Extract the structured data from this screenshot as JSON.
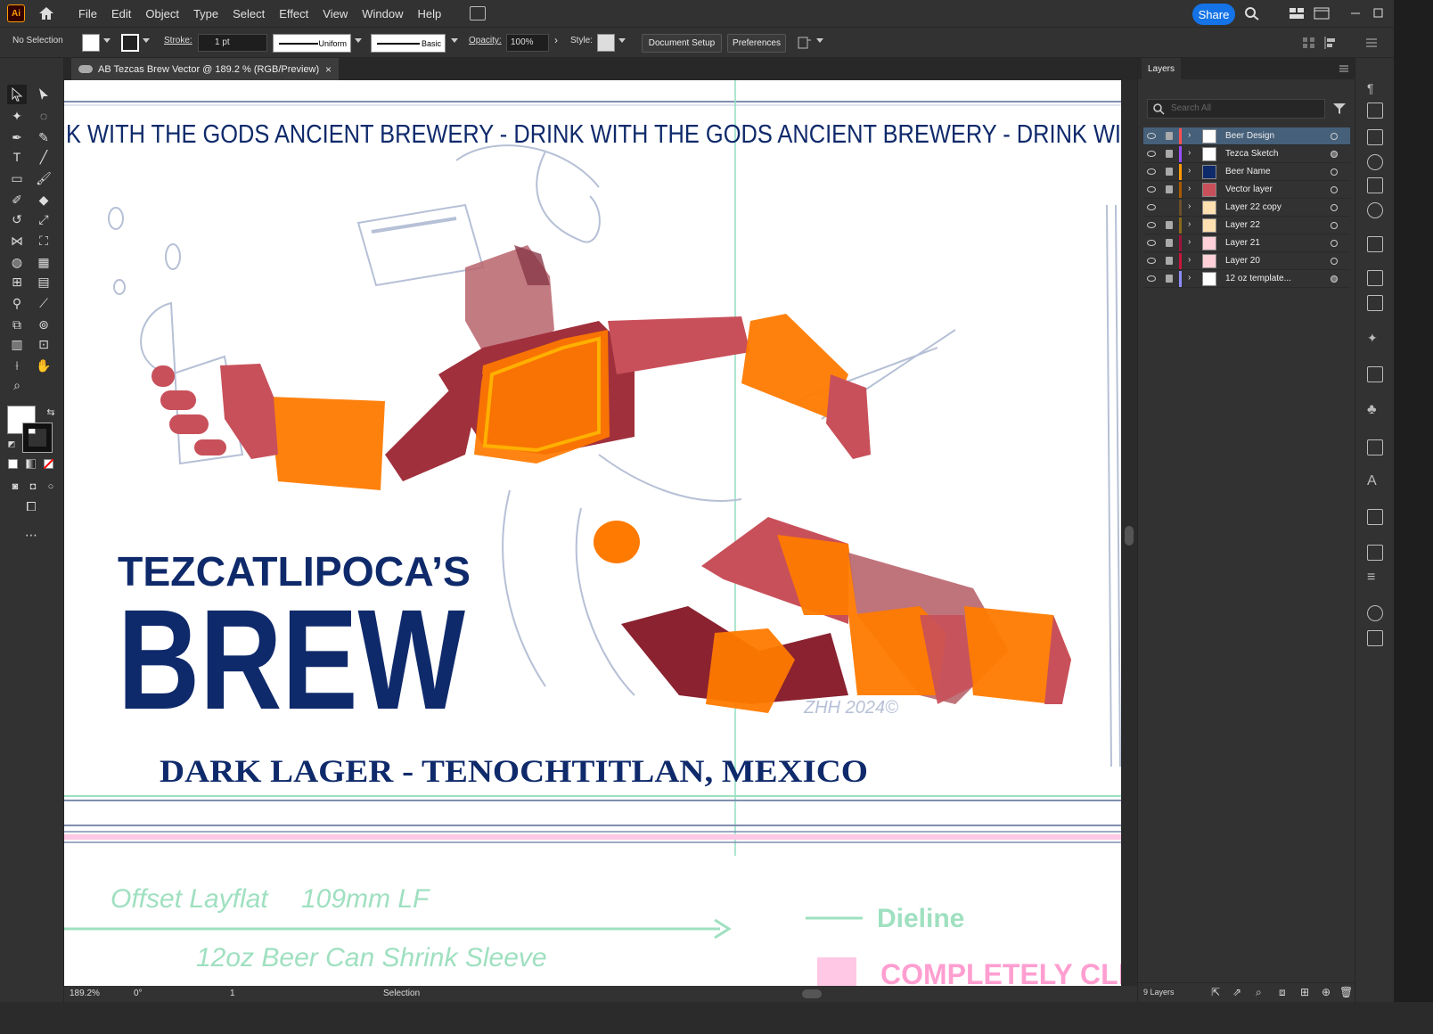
{
  "app": {
    "logo": "Ai",
    "menus": [
      "File",
      "Edit",
      "Object",
      "Type",
      "Select",
      "Effect",
      "View",
      "Window",
      "Help"
    ],
    "share_label": "Share"
  },
  "control": {
    "selection": "No Selection",
    "stroke_label": "Stroke:",
    "stroke_weight": "1 pt",
    "profile_uniform": "Uniform",
    "brush_basic": "Basic",
    "opacity_label": "Opacity:",
    "opacity_value": "100%",
    "style_label": "Style:",
    "document_setup": "Document Setup",
    "preferences": "Preferences"
  },
  "document": {
    "tab_title": "AB Tezcas Brew Vector @ 189.2 % (RGB/Preview)",
    "close": "×"
  },
  "artwork": {
    "banner": "K WITH THE GODS   ANCIENT BREWERY - DRINK WITH THE GODS   ANCIENT BREWERY - DRINK WI",
    "brand_top": "TEZCATLIPOCA’S",
    "brand_main": "BREW",
    "subtitle": "DARK LAGER - TENOCHTITLAN, MEXICO",
    "signature": "ZHH 2024©",
    "template_offset": "Offset Layflat",
    "template_lf": "109mm LF",
    "template_sleeve": "12oz Beer Can Shrink Sleeve",
    "dieline": "Dieline",
    "completely_clear": "COMPLETELY CLE"
  },
  "status": {
    "zoom": "189.2%",
    "angle": "0°",
    "artboard": "1",
    "tool": "Selection"
  },
  "layers_panel": {
    "title": "Layers",
    "search_placeholder": "Search All",
    "count": "9 Layers",
    "layers": [
      {
        "name": "Beer Design",
        "color": "#ff4f4f",
        "selected": true,
        "visible": true,
        "locked": true
      },
      {
        "name": "Tezca Sketch",
        "color": "#9a4fff",
        "selected": false,
        "visible": true,
        "locked": true
      },
      {
        "name": "Beer Name",
        "color": "#ff9a00",
        "selected": false,
        "visible": true,
        "locked": true
      },
      {
        "name": "Vector layer",
        "color": "#a85a00",
        "selected": false,
        "visible": true,
        "locked": true
      },
      {
        "name": "Layer 22 copy",
        "color": "#6b4f2a",
        "selected": false,
        "visible": true,
        "locked": false
      },
      {
        "name": "Layer 22",
        "color": "#8a6a1a",
        "selected": false,
        "visible": true,
        "locked": true
      },
      {
        "name": "Layer 21",
        "color": "#a0143c",
        "selected": false,
        "visible": true,
        "locked": true
      },
      {
        "name": "Layer 20",
        "color": "#c8143c",
        "selected": false,
        "visible": true,
        "locked": true
      },
      {
        "name": "12 oz template...",
        "color": "#8c8cff",
        "selected": false,
        "visible": true,
        "locked": true
      }
    ]
  },
  "colors": {
    "brand_navy": "#0f2a6b",
    "armor_orange": "#ff7a00",
    "skin": "#c8505a",
    "dieline_green": "#9fe0c0",
    "pink": "#ff9ed0",
    "accent_blue": "#1473e6"
  }
}
